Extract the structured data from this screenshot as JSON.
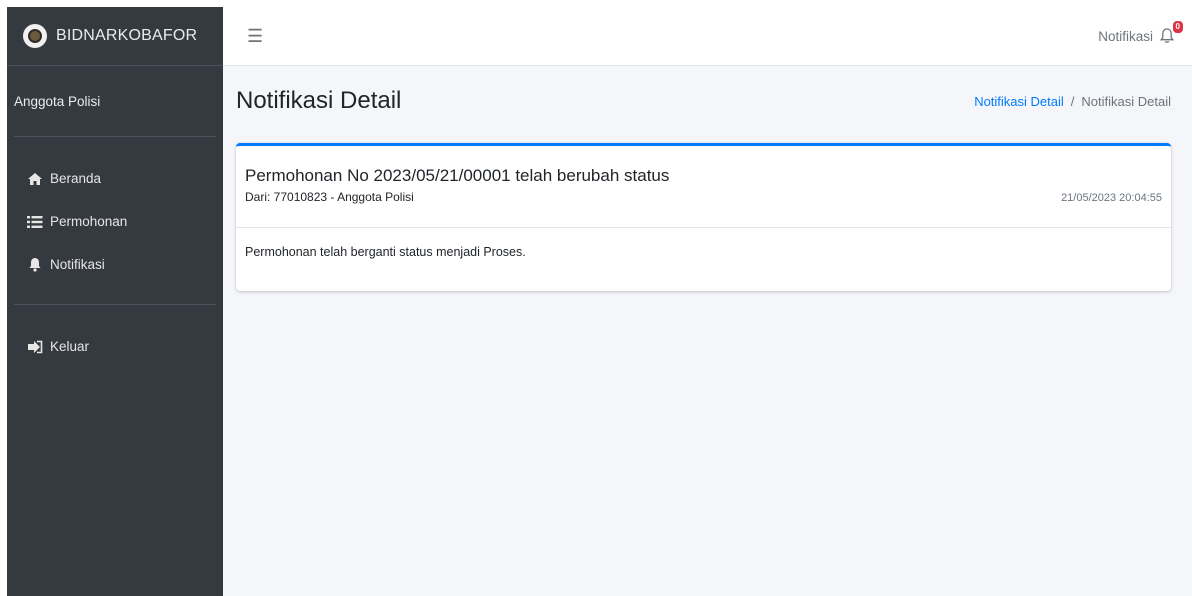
{
  "brand": {
    "name": "BIDNARKOBAFOR"
  },
  "user": {
    "name": "Anggota Polisi"
  },
  "sidebar": {
    "items": [
      {
        "label": "Beranda",
        "icon": "home-icon"
      },
      {
        "label": "Permohonan",
        "icon": "list-icon"
      },
      {
        "label": "Notifikasi",
        "icon": "bell-icon"
      }
    ],
    "logout": {
      "label": "Keluar",
      "icon": "sign-out-icon"
    }
  },
  "topbar": {
    "notif_label": "Notifikasi",
    "notif_count": "0"
  },
  "page": {
    "title": "Notifikasi Detail",
    "breadcrumb_link": "Notifikasi Detail",
    "breadcrumb_sep": "/",
    "breadcrumb_current": "Notifikasi Detail"
  },
  "notification": {
    "title": "Permohonan No 2023/05/21/00001 telah berubah status",
    "from": "Dari: 77010823 - Anggota Polisi",
    "timestamp": "21/05/2023 20:04:55",
    "message": "Permohonan telah berganti status menjadi Proses."
  },
  "colors": {
    "sidebar_bg": "#343a40",
    "accent": "#007bff",
    "badge": "#dc3545",
    "content_bg": "#f4f6f9"
  }
}
